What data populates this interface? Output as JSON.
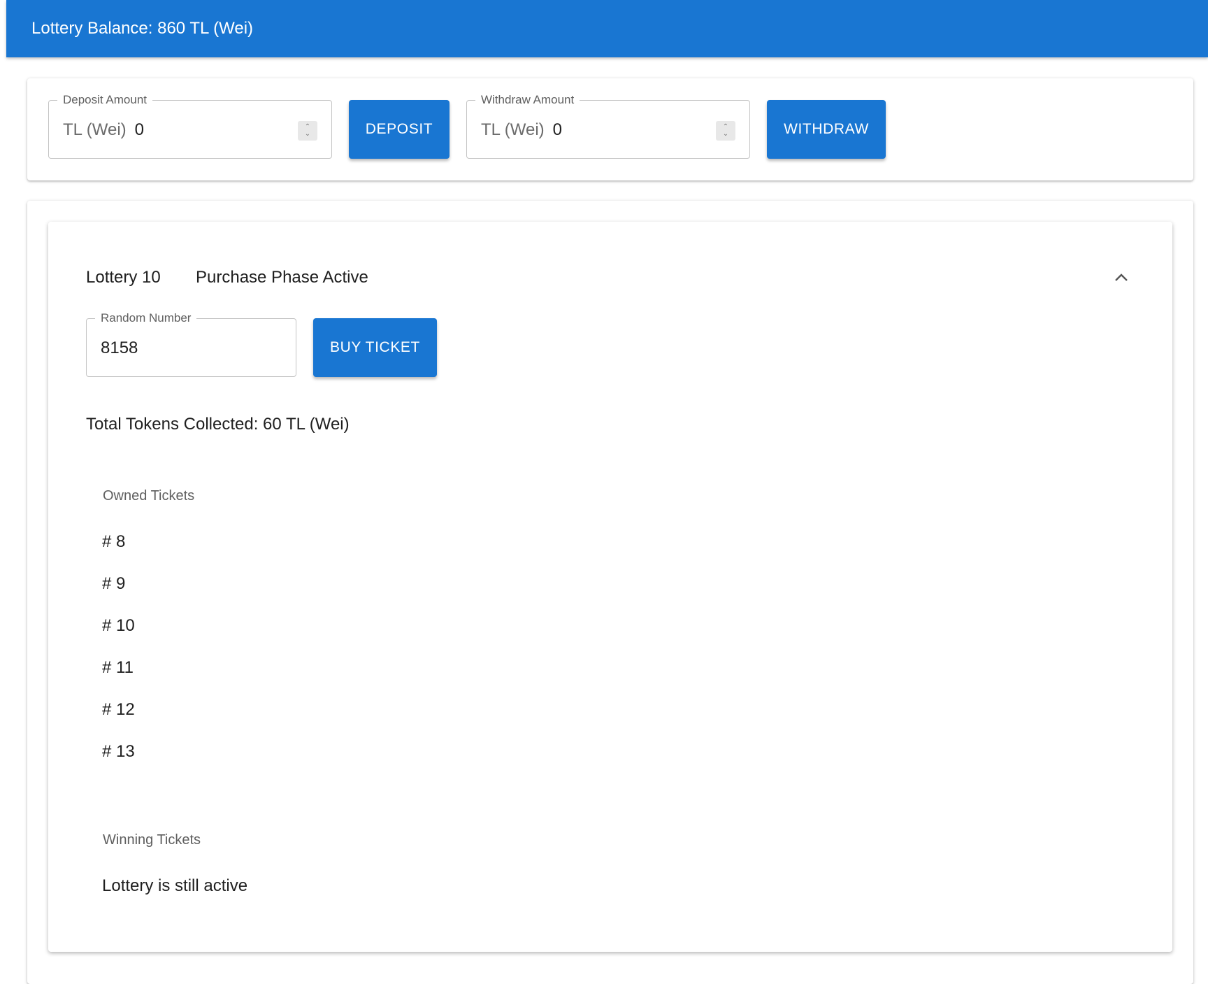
{
  "appbar": {
    "balance_text": "Lottery Balance: 860 TL (Wei)"
  },
  "deposit": {
    "label": "Deposit Amount",
    "unit": "TL (Wei)",
    "value": "0",
    "button": "DEPOSIT"
  },
  "withdraw": {
    "label": "Withdraw Amount",
    "unit": "TL (Wei)",
    "value": "0",
    "button": "WITHDRAW"
  },
  "lottery": {
    "title": "Lottery 10",
    "phase": "Purchase Phase Active",
    "random_label": "Random Number",
    "random_value": "8158",
    "buy_button": "BUY TICKET",
    "total_tokens": "Total Tokens Collected: 60 TL (Wei)",
    "owned_header": "Owned Tickets",
    "owned_tickets": [
      "# 8",
      "# 9",
      "# 10",
      "# 11",
      "# 12",
      "# 13"
    ],
    "winning_header": "Winning Tickets",
    "winning_status": "Lottery is still active"
  },
  "colors": {
    "primary": "#1976d2",
    "outline": "#c4c4c4"
  },
  "icons": {
    "collapse": "chevron-up-icon",
    "spinner": "number-spinner-icon"
  }
}
